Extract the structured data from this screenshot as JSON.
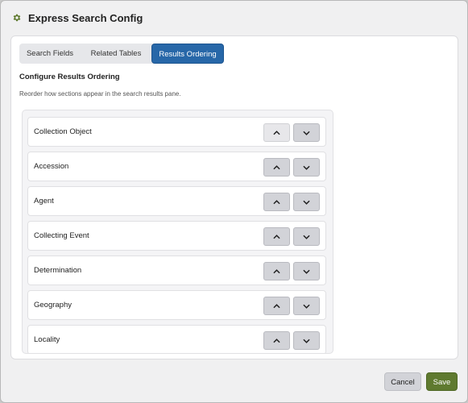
{
  "dialog": {
    "title": "Express Search Config"
  },
  "tabs": [
    {
      "label": "Search Fields",
      "active": false
    },
    {
      "label": "Related Tables",
      "active": false
    },
    {
      "label": "Results Ordering",
      "active": true
    }
  ],
  "section": {
    "title": "Configure Results Ordering",
    "description": "Reorder how sections appear in the search results pane."
  },
  "ordering": [
    {
      "label": "Collection Object",
      "up_disabled": true
    },
    {
      "label": "Accession",
      "up_disabled": false
    },
    {
      "label": "Agent",
      "up_disabled": false
    },
    {
      "label": "Collecting Event",
      "up_disabled": false
    },
    {
      "label": "Determination",
      "up_disabled": false
    },
    {
      "label": "Geography",
      "up_disabled": false
    },
    {
      "label": "Locality",
      "up_disabled": false
    }
  ],
  "footer": {
    "cancel_label": "Cancel",
    "save_label": "Save"
  },
  "colors": {
    "accent": "#2767a8",
    "save": "#5f7a2f",
    "gear": "#5f7a2f"
  },
  "icons": {
    "title": "gear-icon",
    "up": "chevron-up-icon",
    "down": "chevron-down-icon"
  }
}
